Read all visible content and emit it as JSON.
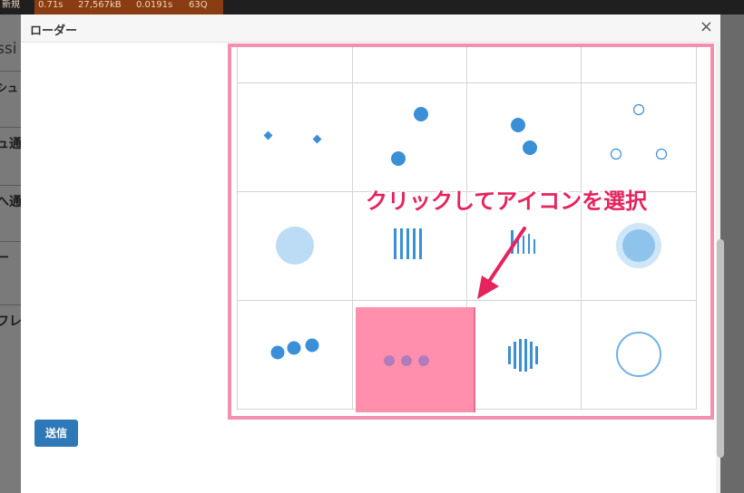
{
  "topbar": {
    "items": [
      "新規",
      "0.71s",
      "27,567kB",
      "0.0191s",
      "63Q"
    ]
  },
  "background": {
    "sidebar_items": [
      "ssi",
      "シュ",
      "ュ通",
      "へ通",
      "ー",
      "フレ"
    ]
  },
  "modal": {
    "title": "ローダー",
    "close_glyph": "×",
    "annotation": "クリックしてアイコンを選択",
    "send_label": "送信"
  },
  "loader_icons": {
    "accent_color": "#3b8fd6",
    "highlight_color": "#ff8fad",
    "frame_color": "#f48fb0",
    "annotation_color": "#e5245e",
    "selected_index": 9,
    "cells": [
      {
        "icon": "two-diamonds-icon"
      },
      {
        "icon": "two-dots-diagonal-icon"
      },
      {
        "icon": "two-dots-offset-icon"
      },
      {
        "icon": "three-rings-icon"
      },
      {
        "icon": "pulse-circle-icon"
      },
      {
        "icon": "bars-icon"
      },
      {
        "icon": "short-bars-icon"
      },
      {
        "icon": "ripple-circle-icon"
      },
      {
        "icon": "three-dots-rising-icon"
      },
      {
        "icon": "three-dots-icon"
      },
      {
        "icon": "wave-bars-icon"
      },
      {
        "icon": "ring-icon"
      }
    ]
  }
}
